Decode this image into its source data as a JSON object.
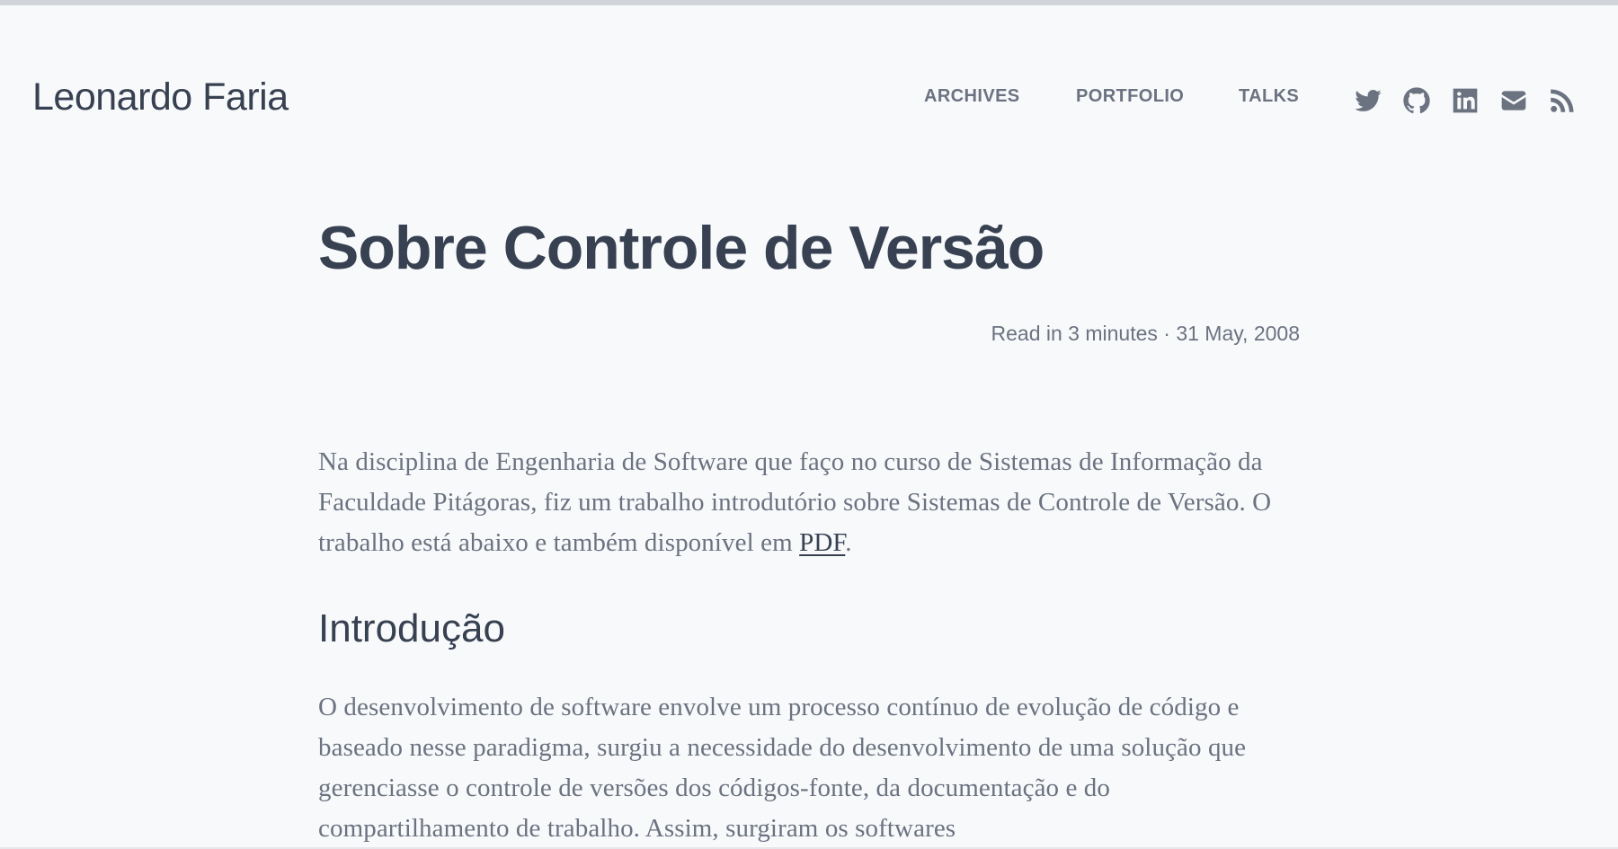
{
  "site": {
    "title": "Leonardo Faria"
  },
  "nav": {
    "items": [
      {
        "label": "ARCHIVES"
      },
      {
        "label": "PORTFOLIO"
      },
      {
        "label": "TALKS"
      }
    ]
  },
  "social": {
    "icons": [
      "twitter-icon",
      "github-icon",
      "linkedin-icon",
      "email-icon",
      "rss-icon"
    ]
  },
  "post": {
    "title": "Sobre Controle de Versão",
    "meta": "Read in 3 minutes · 31 May, 2008",
    "intro_before_link": "Na disciplina de Engenharia de Software que faço no curso de Sistemas de Informação da Faculdade Pitágoras, fiz um trabalho introdutório sobre Sistemas de Controle de Versão. O trabalho está abaixo e também disponível em ",
    "intro_link": "PDF",
    "intro_after_link": ".",
    "section_heading": "Introdução",
    "section_paragraph": "O desenvolvimento de software envolve um processo contínuo de evolução de código e baseado nesse paradigma, surgiu a necessidade do desenvolvimento de uma solução que gerenciasse o controle de versões dos códigos-fonte, da documentação e do compartilhamento de trabalho. Assim, surgiram os softwares"
  },
  "colors": {
    "background": "#f8f9fb",
    "heading": "#374151",
    "muted": "#6b7280"
  }
}
